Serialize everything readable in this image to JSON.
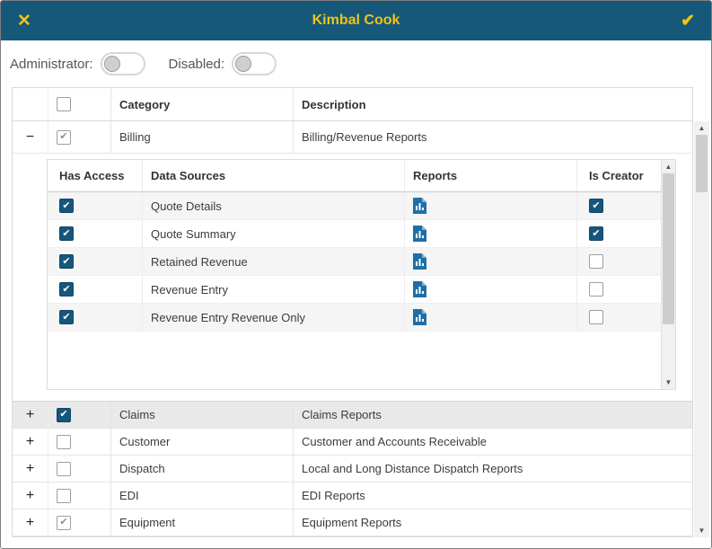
{
  "window": {
    "title": "Kimbal Cook"
  },
  "titlebar": {
    "close_icon": "✕",
    "confirm_icon": "✔"
  },
  "toggles": {
    "administrator_label": "Administrator:",
    "disabled_label": "Disabled:",
    "administrator_state": "off",
    "disabled_state": "off"
  },
  "icons": {
    "scroll_up": "▲",
    "scroll_down": "▼"
  },
  "main_table": {
    "header_checkbox_state": "unchecked",
    "columns": {
      "category": "Category",
      "description": "Description"
    },
    "rows": [
      {
        "expand_icon": "−",
        "state": "gray",
        "category": "Billing",
        "description": "Billing/Revenue Reports"
      },
      {
        "expand_icon": "+",
        "state": "checked",
        "category": "Claims",
        "description": "Claims Reports"
      },
      {
        "expand_icon": "+",
        "state": "unchecked",
        "category": "Customer",
        "description": "Customer and Accounts Receivable"
      },
      {
        "expand_icon": "+",
        "state": "unchecked",
        "category": "Dispatch",
        "description": "Local and Long Distance Dispatch Reports"
      },
      {
        "expand_icon": "+",
        "state": "unchecked",
        "category": "EDI",
        "description": "EDI Reports"
      },
      {
        "expand_icon": "+",
        "state": "gray",
        "category": "Equipment",
        "description": "Equipment Reports"
      }
    ]
  },
  "sub_table": {
    "columns": {
      "has_access": "Has Access",
      "data_sources": "Data Sources",
      "reports": "Reports",
      "is_creator": "Is Creator"
    },
    "rows": [
      {
        "has_access": "checked",
        "name": "Quote Details",
        "is_creator": "checked"
      },
      {
        "has_access": "checked",
        "name": "Quote Summary",
        "is_creator": "checked"
      },
      {
        "has_access": "checked",
        "name": "Retained Revenue",
        "is_creator": "unchecked"
      },
      {
        "has_access": "checked",
        "name": "Revenue Entry",
        "is_creator": "unchecked"
      },
      {
        "has_access": "checked",
        "name": "Revenue Entry Revenue Only",
        "is_creator": "unchecked"
      }
    ]
  },
  "colors": {
    "titlebar_bg": "#15587A",
    "accent_yellow": "#F0C413",
    "checkbox_checked": "#17567C",
    "report_icon_blue": "#1E6FA8",
    "selected_row_bg": "#E9E9E9"
  }
}
